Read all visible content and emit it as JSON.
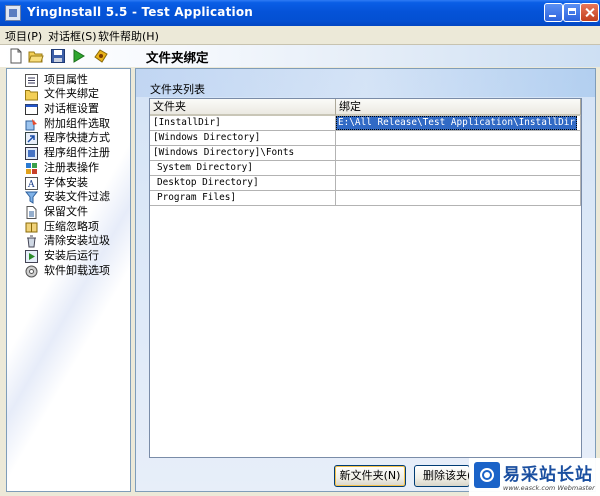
{
  "window": {
    "title": "YingInstall 5.5 - Test Application"
  },
  "menubar": {
    "items": [
      {
        "label": "项目(P)"
      },
      {
        "label": "对话框(S)"
      },
      {
        "label": "软件帮助(H)"
      }
    ]
  },
  "toolbar": {
    "buttons": [
      {
        "icon": "new-document-icon"
      },
      {
        "icon": "open-folder-icon"
      },
      {
        "icon": "save-disk-icon"
      },
      {
        "icon": "run-play-icon"
      },
      {
        "icon": "help-icon"
      }
    ],
    "banner": "文件夹绑定"
  },
  "sidebar": {
    "items": [
      {
        "label": "项目属性",
        "icon": "properties-grid-icon"
      },
      {
        "label": "文件夹绑定",
        "icon": "folder-icon",
        "selected": true
      },
      {
        "label": "对话框设置",
        "icon": "dialog-window-icon"
      },
      {
        "label": "附加组件选取",
        "icon": "addon-component-icon"
      },
      {
        "label": "程序快捷方式",
        "icon": "shortcut-icon"
      },
      {
        "label": "程序组件注册",
        "icon": "component-register-icon"
      },
      {
        "label": "注册表操作",
        "icon": "registry-icon"
      },
      {
        "label": "字体安装",
        "icon": "font-icon"
      },
      {
        "label": "安装文件过滤",
        "icon": "filter-icon"
      },
      {
        "label": "保留文件",
        "icon": "keep-file-icon"
      },
      {
        "label": "压缩忽略项",
        "icon": "compress-ignore-icon"
      },
      {
        "label": "清除安装垃圾",
        "icon": "cleanup-icon"
      },
      {
        "label": "安装后运行",
        "icon": "run-after-install-icon"
      },
      {
        "label": "软件卸载选项",
        "icon": "uninstall-options-icon"
      }
    ]
  },
  "main": {
    "section_label": "文件夹列表",
    "columns": [
      "文件夹",
      "绑定"
    ],
    "rows": [
      {
        "folder": "[InstallDir]",
        "binding": "E:\\All Release\\Test Application\\InstallDir",
        "selected": true
      },
      {
        "folder": "[Windows Directory]",
        "binding": ""
      },
      {
        "folder": "[Windows Directory]\\Fonts",
        "binding": ""
      },
      {
        "folder": "System Directory]",
        "binding": ""
      },
      {
        "folder": "Desktop Directory]",
        "binding": ""
      },
      {
        "folder": "Program Files]",
        "binding": ""
      }
    ],
    "buttons": {
      "new_folder": "新文件夹(N)",
      "delete": "删除该夹(D)"
    }
  },
  "watermark": {
    "title": "易采站长站",
    "url": "www.easck.com  Webmaster"
  },
  "colors": {
    "titlebar": "#0553d8",
    "selection": "#316ac5",
    "panel": "#ece9d8"
  }
}
